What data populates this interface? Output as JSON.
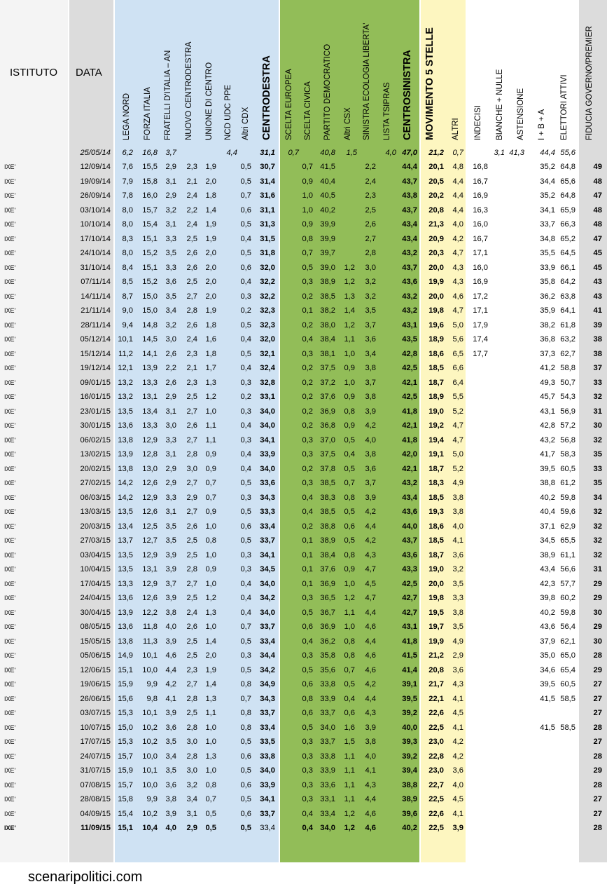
{
  "colors": {
    "cdx_band": "#cfe2f3",
    "csx_band": "#92bd58",
    "m5s_band": "#fdf6c0",
    "gray_band": "#dcdcdc"
  },
  "headers": {
    "istituto": "ISTITUTO",
    "data": "DATA",
    "columns": [
      "LEGA NORD",
      "FORZA ITALIA",
      "FRATELLI D'ITALIA – AN",
      "NUOVO CENTRODESTRA",
      "UNIONE DI CENTRO",
      "NCD UDC PPE",
      "Altri CDX",
      "CENTRODESTRA",
      "SCELTA EUROPEA",
      "SCELTA CIVICA",
      "PARTITO DEMOCRATICO",
      "Altri CSX",
      "SINISTRA ECOLOGIA LIBERTA'",
      "LISTA TSIPRAS",
      "CENTROSINISTRA",
      "MOVIMENTO 5 STELLE",
      "ALTRI",
      "INDECISI",
      "BIANCHE + NULLE",
      "ASTENSIONE",
      "I + B + A",
      "ELETTORI ATTIVI",
      "FIDUCIA GOVERNO/PREMIER"
    ]
  },
  "reference_row": {
    "data": "25/05/14",
    "values": {
      "ln": "6,2",
      "fi": "16,8",
      "fdi": "3,7",
      "ncdudc": "4,4",
      "cdx": "31,1",
      "se": "0,7",
      "pd": "40,8",
      "acsx": "1,5",
      "tsip": "4,0",
      "csx": "47,0",
      "m5s": "21,2",
      "altri": "0,7",
      "bn": "3,1",
      "ast": "41,3",
      "iba": "44,4",
      "ea": "55,6"
    }
  },
  "rows": [
    [
      "IXE'",
      "12/09/14",
      "7,6",
      "15,5",
      "2,9",
      "2,3",
      "1,9",
      "0,5",
      "30,7",
      "0,7",
      "41,5",
      "",
      "2,2",
      "44,4",
      "20,1",
      "4,8",
      "16,8",
      "35,2",
      "64,8",
      "49"
    ],
    [
      "IXE'",
      "19/09/14",
      "7,9",
      "15,8",
      "3,1",
      "2,1",
      "2,0",
      "0,5",
      "31,4",
      "0,9",
      "40,4",
      "",
      "2,4",
      "43,7",
      "20,5",
      "4,4",
      "16,7",
      "34,4",
      "65,6",
      "48"
    ],
    [
      "IXE'",
      "26/09/14",
      "7,8",
      "16,0",
      "2,9",
      "2,4",
      "1,8",
      "0,7",
      "31,6",
      "1,0",
      "40,5",
      "",
      "2,3",
      "43,8",
      "20,2",
      "4,4",
      "16,9",
      "35,2",
      "64,8",
      "47"
    ],
    [
      "IXE'",
      "03/10/14",
      "8,0",
      "15,7",
      "3,2",
      "2,2",
      "1,4",
      "0,6",
      "31,1",
      "1,0",
      "40,2",
      "",
      "2,5",
      "43,7",
      "20,8",
      "4,4",
      "16,3",
      "34,1",
      "65,9",
      "48"
    ],
    [
      "IXE'",
      "10/10/14",
      "8,0",
      "15,4",
      "3,1",
      "2,4",
      "1,9",
      "0,5",
      "31,3",
      "0,9",
      "39,9",
      "",
      "2,6",
      "43,4",
      "21,3",
      "4,0",
      "16,0",
      "33,7",
      "66,3",
      "48"
    ],
    [
      "IXE'",
      "17/10/14",
      "8,3",
      "15,1",
      "3,3",
      "2,5",
      "1,9",
      "0,4",
      "31,5",
      "0,8",
      "39,9",
      "",
      "2,7",
      "43,4",
      "20,9",
      "4,2",
      "16,7",
      "34,8",
      "65,2",
      "47"
    ],
    [
      "IXE'",
      "24/10/14",
      "8,0",
      "15,2",
      "3,5",
      "2,6",
      "2,0",
      "0,5",
      "31,8",
      "0,7",
      "39,7",
      "",
      "2,8",
      "43,2",
      "20,3",
      "4,7",
      "17,1",
      "35,5",
      "64,5",
      "45"
    ],
    [
      "IXE'",
      "31/10/14",
      "8,4",
      "15,1",
      "3,3",
      "2,6",
      "2,0",
      "0,6",
      "32,0",
      "0,5",
      "39,0",
      "1,2",
      "3,0",
      "43,7",
      "20,0",
      "4,3",
      "16,0",
      "33,9",
      "66,1",
      "45"
    ],
    [
      "IXE'",
      "07/11/14",
      "8,5",
      "15,2",
      "3,6",
      "2,5",
      "2,0",
      "0,4",
      "32,2",
      "0,3",
      "38,9",
      "1,2",
      "3,2",
      "43,6",
      "19,9",
      "4,3",
      "16,9",
      "35,8",
      "64,2",
      "43"
    ],
    [
      "IXE'",
      "14/11/14",
      "8,7",
      "15,0",
      "3,5",
      "2,7",
      "2,0",
      "0,3",
      "32,2",
      "0,2",
      "38,5",
      "1,3",
      "3,2",
      "43,2",
      "20,0",
      "4,6",
      "17,2",
      "36,2",
      "63,8",
      "43"
    ],
    [
      "IXE'",
      "21/11/14",
      "9,0",
      "15,0",
      "3,4",
      "2,8",
      "1,9",
      "0,2",
      "32,3",
      "0,1",
      "38,2",
      "1,4",
      "3,5",
      "43,2",
      "19,8",
      "4,7",
      "17,1",
      "35,9",
      "64,1",
      "41"
    ],
    [
      "IXE'",
      "28/11/14",
      "9,4",
      "14,8",
      "3,2",
      "2,6",
      "1,8",
      "0,5",
      "32,3",
      "0,2",
      "38,0",
      "1,2",
      "3,7",
      "43,1",
      "19,6",
      "5,0",
      "17,9",
      "38,2",
      "61,8",
      "39"
    ],
    [
      "IXE'",
      "05/12/14",
      "10,1",
      "14,5",
      "3,0",
      "2,4",
      "1,6",
      "0,4",
      "32,0",
      "0,4",
      "38,4",
      "1,1",
      "3,6",
      "43,5",
      "18,9",
      "5,6",
      "17,4",
      "36,8",
      "63,2",
      "38"
    ],
    [
      "IXE'",
      "15/12/14",
      "11,2",
      "14,1",
      "2,6",
      "2,3",
      "1,8",
      "0,5",
      "32,1",
      "0,3",
      "38,1",
      "1,0",
      "3,4",
      "42,8",
      "18,6",
      "6,5",
      "17,7",
      "37,3",
      "62,7",
      "38"
    ],
    [
      "IXE'",
      "19/12/14",
      "12,1",
      "13,9",
      "2,2",
      "2,1",
      "1,7",
      "0,4",
      "32,4",
      "0,2",
      "37,5",
      "0,9",
      "3,8",
      "42,5",
      "18,5",
      "6,6",
      "",
      "41,2",
      "58,8",
      "37"
    ],
    [
      "IXE'",
      "09/01/15",
      "13,2",
      "13,3",
      "2,6",
      "2,3",
      "1,3",
      "0,3",
      "32,8",
      "0,2",
      "37,2",
      "1,0",
      "3,7",
      "42,1",
      "18,7",
      "6,4",
      "",
      "49,3",
      "50,7",
      "33"
    ],
    [
      "IXE'",
      "16/01/15",
      "13,2",
      "13,1",
      "2,9",
      "2,5",
      "1,2",
      "0,2",
      "33,1",
      "0,2",
      "37,6",
      "0,9",
      "3,8",
      "42,5",
      "18,9",
      "5,5",
      "",
      "45,7",
      "54,3",
      "32"
    ],
    [
      "IXE'",
      "23/01/15",
      "13,5",
      "13,4",
      "3,1",
      "2,7",
      "1,0",
      "0,3",
      "34,0",
      "0,2",
      "36,9",
      "0,8",
      "3,9",
      "41,8",
      "19,0",
      "5,2",
      "",
      "43,1",
      "56,9",
      "31"
    ],
    [
      "IXE'",
      "30/01/15",
      "13,6",
      "13,3",
      "3,0",
      "2,6",
      "1,1",
      "0,4",
      "34,0",
      "0,2",
      "36,8",
      "0,9",
      "4,2",
      "42,1",
      "19,2",
      "4,7",
      "",
      "42,8",
      "57,2",
      "30"
    ],
    [
      "IXE'",
      "06/02/15",
      "13,8",
      "12,9",
      "3,3",
      "2,7",
      "1,1",
      "0,3",
      "34,1",
      "0,3",
      "37,0",
      "0,5",
      "4,0",
      "41,8",
      "19,4",
      "4,7",
      "",
      "43,2",
      "56,8",
      "32"
    ],
    [
      "IXE'",
      "13/02/15",
      "13,9",
      "12,8",
      "3,1",
      "2,8",
      "0,9",
      "0,4",
      "33,9",
      "0,3",
      "37,5",
      "0,4",
      "3,8",
      "42,0",
      "19,1",
      "5,0",
      "",
      "41,7",
      "58,3",
      "35"
    ],
    [
      "IXE'",
      "20/02/15",
      "13,8",
      "13,0",
      "2,9",
      "3,0",
      "0,9",
      "0,4",
      "34,0",
      "0,2",
      "37,8",
      "0,5",
      "3,6",
      "42,1",
      "18,7",
      "5,2",
      "",
      "39,5",
      "60,5",
      "33"
    ],
    [
      "IXE'",
      "27/02/15",
      "14,2",
      "12,6",
      "2,9",
      "2,7",
      "0,7",
      "0,5",
      "33,6",
      "0,3",
      "38,5",
      "0,7",
      "3,7",
      "43,2",
      "18,3",
      "4,9",
      "",
      "38,8",
      "61,2",
      "35"
    ],
    [
      "IXE'",
      "06/03/15",
      "14,2",
      "12,9",
      "3,3",
      "2,9",
      "0,7",
      "0,3",
      "34,3",
      "0,4",
      "38,3",
      "0,8",
      "3,9",
      "43,4",
      "18,5",
      "3,8",
      "",
      "40,2",
      "59,8",
      "34"
    ],
    [
      "IXE'",
      "13/03/15",
      "13,5",
      "12,6",
      "3,1",
      "2,7",
      "0,9",
      "0,5",
      "33,3",
      "0,4",
      "38,5",
      "0,5",
      "4,2",
      "43,6",
      "19,3",
      "3,8",
      "",
      "40,4",
      "59,6",
      "32"
    ],
    [
      "IXE'",
      "20/03/15",
      "13,4",
      "12,5",
      "3,5",
      "2,6",
      "1,0",
      "0,6",
      "33,4",
      "0,2",
      "38,8",
      "0,6",
      "4,4",
      "44,0",
      "18,6",
      "4,0",
      "",
      "37,1",
      "62,9",
      "32"
    ],
    [
      "IXE'",
      "27/03/15",
      "13,7",
      "12,7",
      "3,5",
      "2,5",
      "0,8",
      "0,5",
      "33,7",
      "0,1",
      "38,9",
      "0,5",
      "4,2",
      "43,7",
      "18,5",
      "4,1",
      "",
      "34,5",
      "65,5",
      "32"
    ],
    [
      "IXE'",
      "03/04/15",
      "13,5",
      "12,9",
      "3,9",
      "2,5",
      "1,0",
      "0,3",
      "34,1",
      "0,1",
      "38,4",
      "0,8",
      "4,3",
      "43,6",
      "18,7",
      "3,6",
      "",
      "38,9",
      "61,1",
      "32"
    ],
    [
      "IXE'",
      "10/04/15",
      "13,5",
      "13,1",
      "3,9",
      "2,8",
      "0,9",
      "0,3",
      "34,5",
      "0,1",
      "37,6",
      "0,9",
      "4,7",
      "43,3",
      "19,0",
      "3,2",
      "",
      "43,4",
      "56,6",
      "31"
    ],
    [
      "IXE'",
      "17/04/15",
      "13,3",
      "12,9",
      "3,7",
      "2,7",
      "1,0",
      "0,4",
      "34,0",
      "0,1",
      "36,9",
      "1,0",
      "4,5",
      "42,5",
      "20,0",
      "3,5",
      "",
      "42,3",
      "57,7",
      "29"
    ],
    [
      "IXE'",
      "24/04/15",
      "13,6",
      "12,6",
      "3,9",
      "2,5",
      "1,2",
      "0,4",
      "34,2",
      "0,3",
      "36,5",
      "1,2",
      "4,7",
      "42,7",
      "19,8",
      "3,3",
      "",
      "39,8",
      "60,2",
      "29"
    ],
    [
      "IXE'",
      "30/04/15",
      "13,9",
      "12,2",
      "3,8",
      "2,4",
      "1,3",
      "0,4",
      "34,0",
      "0,5",
      "36,7",
      "1,1",
      "4,4",
      "42,7",
      "19,5",
      "3,8",
      "",
      "40,2",
      "59,8",
      "30"
    ],
    [
      "IXE'",
      "08/05/15",
      "13,6",
      "11,8",
      "4,0",
      "2,6",
      "1,0",
      "0,7",
      "33,7",
      "0,6",
      "36,9",
      "1,0",
      "4,6",
      "43,1",
      "19,7",
      "3,5",
      "",
      "43,6",
      "56,4",
      "29"
    ],
    [
      "IXE'",
      "15/05/15",
      "13,8",
      "11,3",
      "3,9",
      "2,5",
      "1,4",
      "0,5",
      "33,4",
      "0,4",
      "36,2",
      "0,8",
      "4,4",
      "41,8",
      "19,9",
      "4,9",
      "",
      "37,9",
      "62,1",
      "30"
    ],
    [
      "IXE'",
      "05/06/15",
      "14,9",
      "10,1",
      "4,6",
      "2,5",
      "2,0",
      "0,3",
      "34,4",
      "0,3",
      "35,8",
      "0,8",
      "4,6",
      "41,5",
      "21,2",
      "2,9",
      "",
      "35,0",
      "65,0",
      "28"
    ],
    [
      "IXE'",
      "12/06/15",
      "15,1",
      "10,0",
      "4,4",
      "2,3",
      "1,9",
      "0,5",
      "34,2",
      "0,5",
      "35,6",
      "0,7",
      "4,6",
      "41,4",
      "20,8",
      "3,6",
      "",
      "34,6",
      "65,4",
      "29"
    ],
    [
      "IXE'",
      "19/06/15",
      "15,9",
      "9,9",
      "4,2",
      "2,7",
      "1,4",
      "0,8",
      "34,9",
      "0,6",
      "33,8",
      "0,5",
      "4,2",
      "39,1",
      "21,7",
      "4,3",
      "",
      "39,5",
      "60,5",
      "27"
    ],
    [
      "IXE'",
      "26/06/15",
      "15,6",
      "9,8",
      "4,1",
      "2,8",
      "1,3",
      "0,7",
      "34,3",
      "0,8",
      "33,9",
      "0,4",
      "4,4",
      "39,5",
      "22,1",
      "4,1",
      "",
      "41,5",
      "58,5",
      "27"
    ],
    [
      "IXE'",
      "03/07/15",
      "15,3",
      "10,1",
      "3,9",
      "2,5",
      "1,1",
      "0,8",
      "33,7",
      "0,6",
      "33,7",
      "0,6",
      "4,3",
      "39,2",
      "22,6",
      "4,5",
      "",
      "",
      "",
      "27"
    ],
    [
      "IXE'",
      "10/07/15",
      "15,0",
      "10,2",
      "3,6",
      "2,8",
      "1,0",
      "0,8",
      "33,4",
      "0,5",
      "34,0",
      "1,6",
      "3,9",
      "40,0",
      "22,5",
      "4,1",
      "",
      "41,5",
      "58,5",
      "28"
    ],
    [
      "IXE'",
      "17/07/15",
      "15,3",
      "10,2",
      "3,5",
      "3,0",
      "1,0",
      "0,5",
      "33,5",
      "0,3",
      "33,7",
      "1,5",
      "3,8",
      "39,3",
      "23,0",
      "4,2",
      "",
      "",
      "",
      "27"
    ],
    [
      "IXE'",
      "24/07/15",
      "15,7",
      "10,0",
      "3,4",
      "2,8",
      "1,3",
      "0,6",
      "33,8",
      "0,3",
      "33,8",
      "1,1",
      "4,0",
      "39,2",
      "22,8",
      "4,2",
      "",
      "",
      "",
      "28"
    ],
    [
      "IXE'",
      "31/07/15",
      "15,9",
      "10,1",
      "3,5",
      "3,0",
      "1,0",
      "0,5",
      "34,0",
      "0,3",
      "33,9",
      "1,1",
      "4,1",
      "39,4",
      "23,0",
      "3,6",
      "",
      "",
      "",
      "29"
    ],
    [
      "IXE'",
      "07/08/15",
      "15,7",
      "10,0",
      "3,6",
      "3,2",
      "0,8",
      "0,6",
      "33,9",
      "0,3",
      "33,6",
      "1,1",
      "4,3",
      "38,8",
      "22,7",
      "4,0",
      "",
      "",
      "",
      "28"
    ],
    [
      "IXE'",
      "28/08/15",
      "15,8",
      "9,9",
      "3,8",
      "3,4",
      "0,7",
      "0,5",
      "34,1",
      "0,3",
      "33,1",
      "1,1",
      "4,4",
      "38,9",
      "22,5",
      "4,5",
      "",
      "",
      "",
      "27"
    ],
    [
      "IXE'",
      "04/09/15",
      "15,4",
      "10,2",
      "3,9",
      "3,1",
      "0,5",
      "0,6",
      "33,7",
      "0,4",
      "33,4",
      "1,2",
      "4,6",
      "39,6",
      "22,6",
      "4,1",
      "",
      "",
      "",
      "27"
    ],
    [
      "IXE'",
      "11/09/15",
      "15,1",
      "10,4",
      "4,0",
      "2,9",
      "0,5",
      "0,5",
      "33,4",
      "0,4",
      "34,0",
      "1,2",
      "4,6",
      "40,2",
      "22,5",
      "3,9",
      "",
      "",
      "",
      "28"
    ]
  ],
  "footer": "scenaripolitici.com"
}
